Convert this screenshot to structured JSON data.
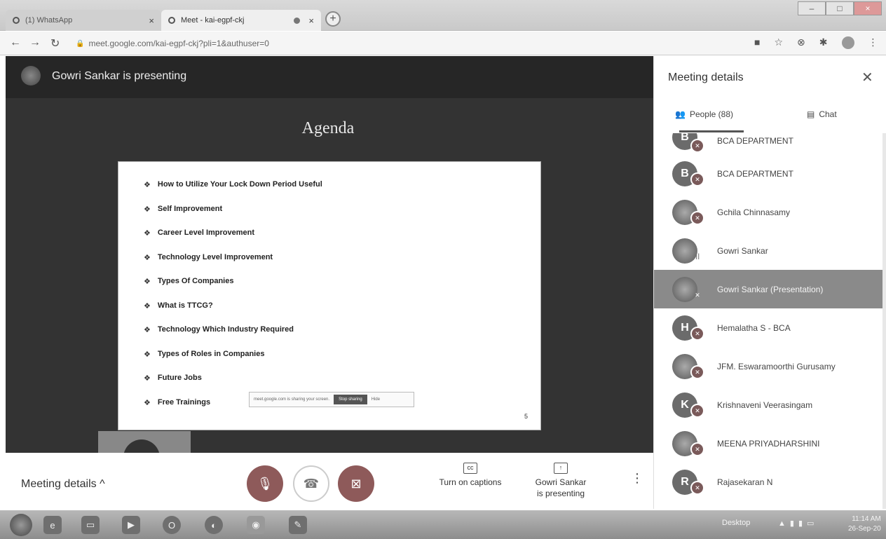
{
  "browser": {
    "tabs": [
      {
        "label": "(1) WhatsApp"
      },
      {
        "label": "Meet - kai-egpf-ckj"
      }
    ],
    "new_tab": "+",
    "url": "meet.google.com/kai-egpf-ckj?pli=1&authuser=0"
  },
  "presentation": {
    "presenter_label": "Gowri Sankar is presenting",
    "slide_title": "Agenda",
    "items": [
      "How to Utilize Your Lock Down Period Useful",
      "Self Improvement",
      "Career Level Improvement",
      "Technology Level Improvement",
      "Types Of Companies",
      "What is TTCG?",
      "Technology Which Industry Required",
      "Types of Roles in Companies",
      "Future Jobs",
      "Free Trainings"
    ],
    "page_number": "5",
    "share_bar": {
      "text": "meet.google.com is sharing your screen.",
      "stop_label": "Stop sharing",
      "hide_label": "Hide"
    }
  },
  "controls": {
    "meeting_details_label": "Meeting details",
    "captions_label": "Turn on captions",
    "presenting_line1": "Gowri Sankar",
    "presenting_line2": "is presenting"
  },
  "panel": {
    "title": "Meeting details",
    "people_tab": "People (88)",
    "chat_tab": "Chat",
    "participants": [
      {
        "initial": "B",
        "name": "BCA DEPARTMENT"
      },
      {
        "initial": "B",
        "name": "BCA DEPARTMENT"
      },
      {
        "initial": "",
        "name": "Gchila Chinnasamy"
      },
      {
        "initial": "",
        "name": "Gowri Sankar"
      },
      {
        "initial": "",
        "name": "Gowri Sankar (Presentation)"
      },
      {
        "initial": "H",
        "name": "Hemalatha S - BCA"
      },
      {
        "initial": "",
        "name": "JFM. Eswaramoorthi Gurusamy"
      },
      {
        "initial": "K",
        "name": "Krishnaveni Veerasingam"
      },
      {
        "initial": "",
        "name": "MEENA PRIYADHARSHINI"
      },
      {
        "initial": "R",
        "name": "Rajasekaran N"
      }
    ]
  },
  "taskbar": {
    "desktop_label": "Desktop",
    "time": "11:14 AM",
    "date": "26-Sep-20"
  }
}
